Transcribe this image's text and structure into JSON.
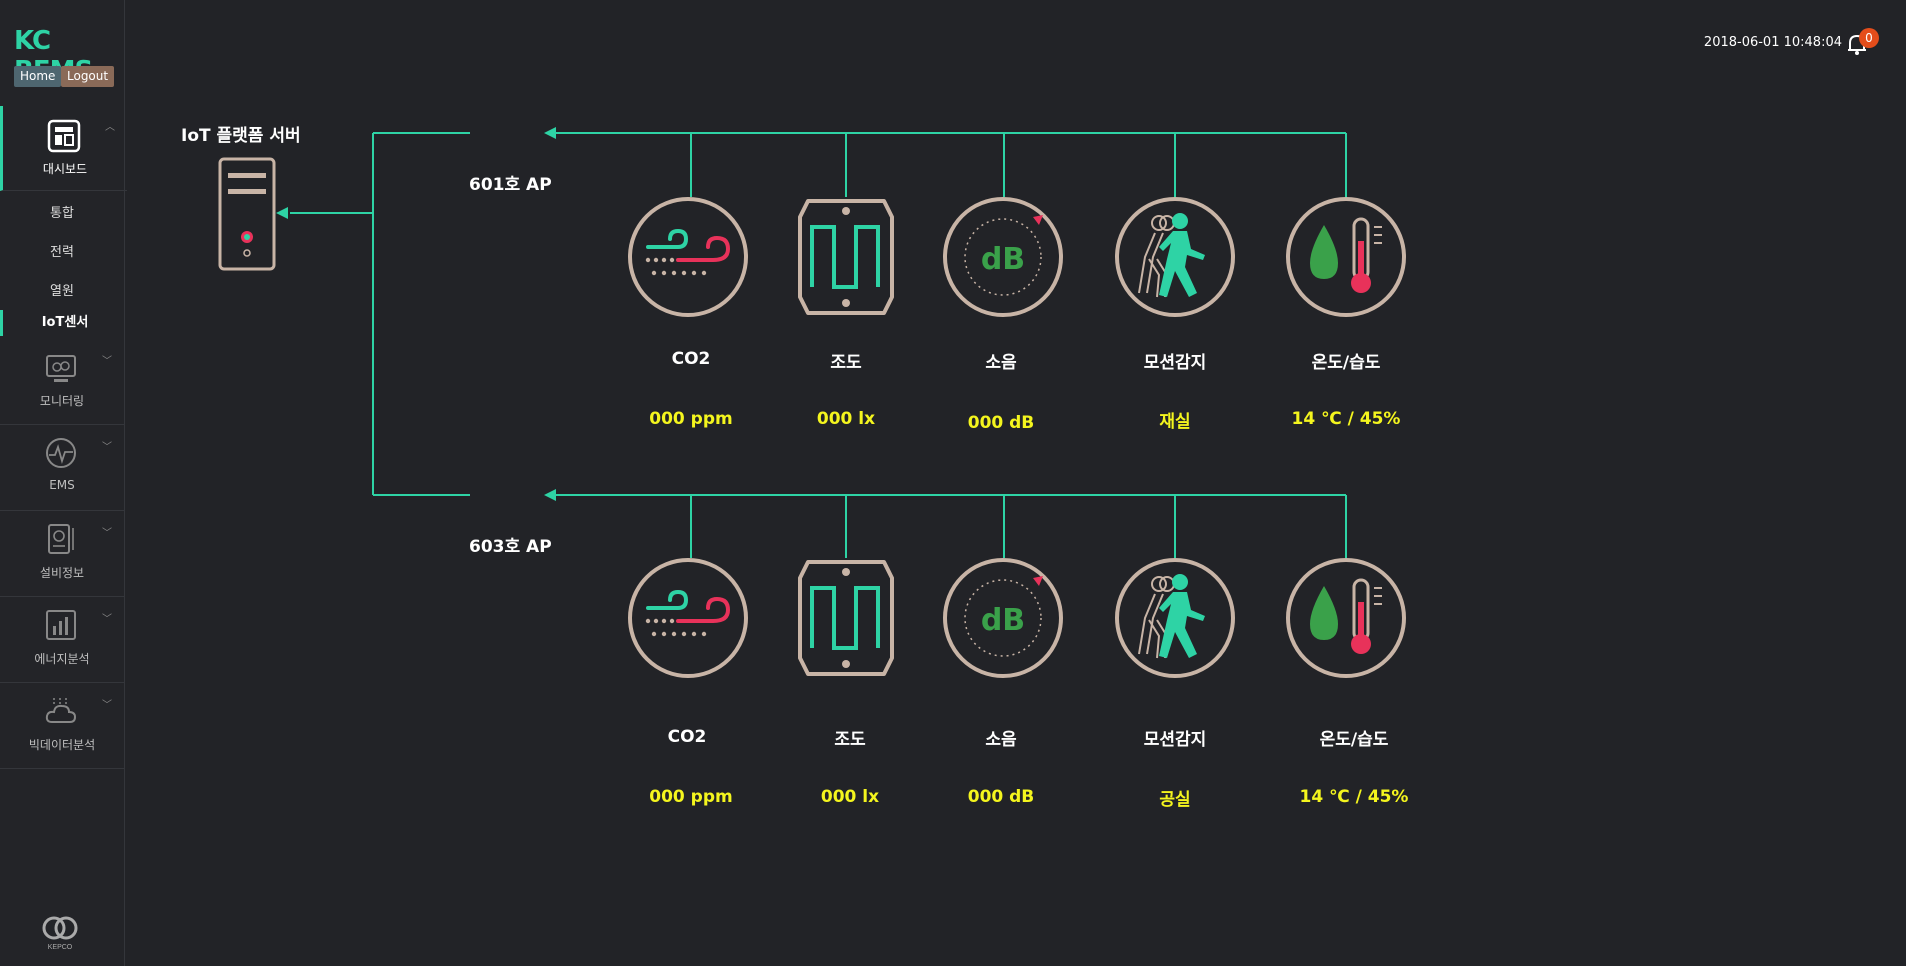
{
  "app": {
    "logo": "KC BEMS",
    "home_label": "Home",
    "logout_label": "Logout",
    "kepco_label": "KEPCO"
  },
  "header": {
    "datetime": "2018-06-01 10:48:04",
    "notification_count": "0"
  },
  "sidebar": {
    "dashboard": {
      "label": "대시보드",
      "icon": "dashboard-icon"
    },
    "sub_items": [
      {
        "label": "통합"
      },
      {
        "label": "전력"
      },
      {
        "label": "열원"
      },
      {
        "label": "IoT센서"
      }
    ],
    "active_sub": "IoT센서",
    "menus": [
      {
        "label": "모니터링",
        "icon": "monitor-icon"
      },
      {
        "label": "EMS",
        "icon": "ems-gauge-icon"
      },
      {
        "label": "설비정보",
        "icon": "equipment-icon"
      },
      {
        "label": "에너지분석",
        "icon": "energy-analysis-icon"
      },
      {
        "label": "빅데이터분석",
        "icon": "bigdata-cloud-icon"
      }
    ]
  },
  "diagram": {
    "server_label": "IoT 플랫폼 서버",
    "aps": [
      {
        "label": "601호 AP",
        "sensors": [
          {
            "name": "CO2",
            "value": "000 ppm",
            "icon": "co2-wind-icon"
          },
          {
            "name": "조도",
            "value": "000 lx",
            "icon": "illuminance-icon"
          },
          {
            "name": "소음",
            "value": "000 dB",
            "icon": "noise-db-icon"
          },
          {
            "name": "모션감지",
            "value": "재실",
            "icon": "motion-walker-icon"
          },
          {
            "name": "온도/습도",
            "value": "14 ℃ / 45%",
            "icon": "temp-humidity-icon"
          }
        ]
      },
      {
        "label": "603호 AP",
        "sensors": [
          {
            "name": "CO2",
            "value": "000 ppm",
            "icon": "co2-wind-icon"
          },
          {
            "name": "조도",
            "value": "000 lx",
            "icon": "illuminance-icon"
          },
          {
            "name": "소음",
            "value": "000 dB",
            "icon": "noise-db-icon"
          },
          {
            "name": "모션감지",
            "value": "공실",
            "icon": "motion-walker-icon"
          },
          {
            "name": "온도/습도",
            "value": "14 ℃ / 45%",
            "icon": "temp-humidity-icon"
          }
        ]
      }
    ]
  },
  "colors": {
    "accent": "#2ed3a5",
    "value": "#f4f51e",
    "ring": "#c8b4a6",
    "alert": "#e8325a",
    "green_drop": "#3aa14a",
    "badge": "#e44d1b"
  }
}
